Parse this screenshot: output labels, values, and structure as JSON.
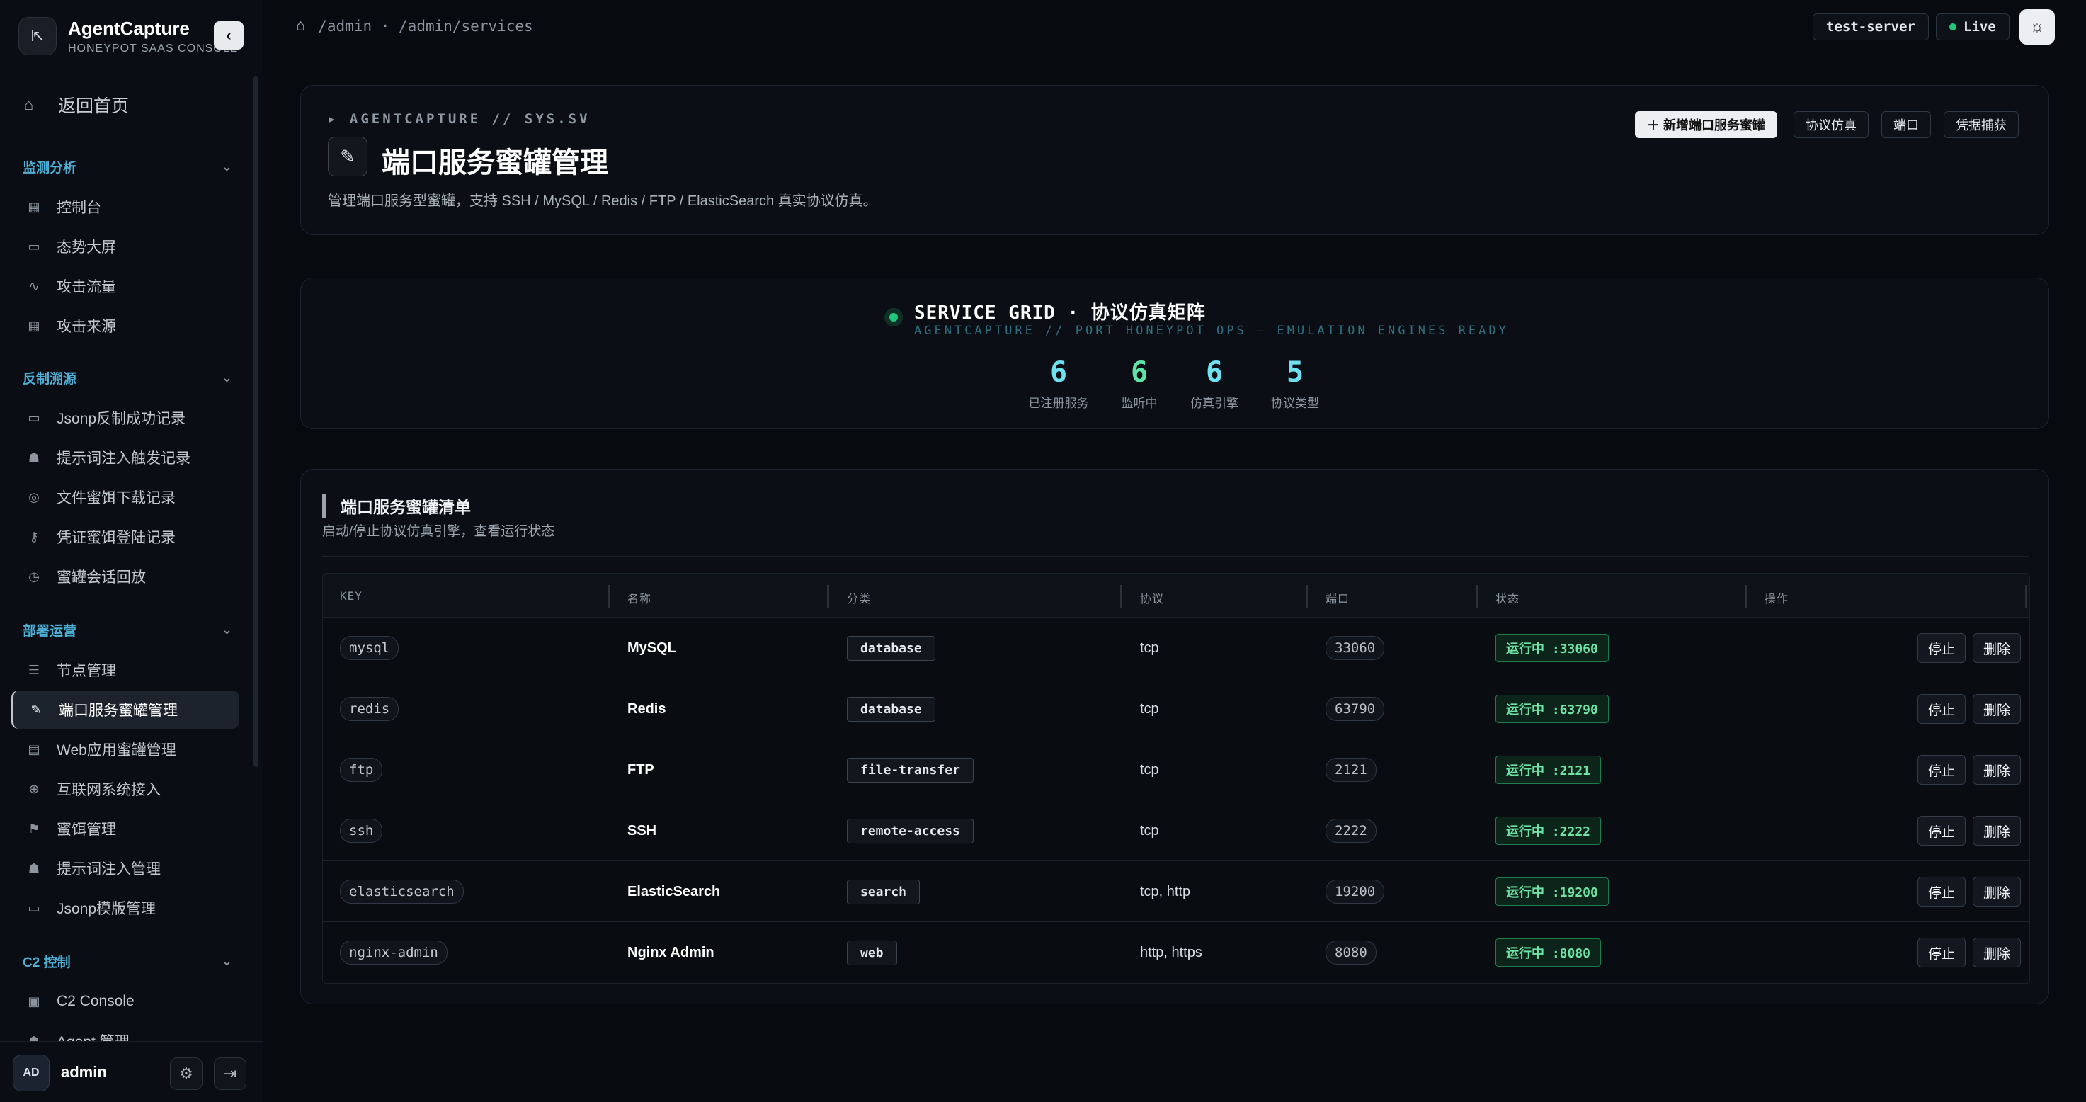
{
  "brand": {
    "name": "AgentCapture",
    "subtitle": "HONEYPOT SAAS CONSOLE"
  },
  "nav": {
    "home": "返回首页",
    "sections": [
      {
        "title": "监测分析",
        "items": [
          "控制台",
          "态势大屏",
          "攻击流量",
          "攻击来源"
        ]
      },
      {
        "title": "反制溯源",
        "items": [
          "Jsonp反制成功记录",
          "提示词注入触发记录",
          "文件蜜饵下载记录",
          "凭证蜜饵登陆记录",
          "蜜罐会话回放"
        ]
      },
      {
        "title": "部署运营",
        "items": [
          "节点管理",
          "端口服务蜜罐管理",
          "Web应用蜜罐管理",
          "互联网系统接入",
          "蜜饵管理",
          "提示词注入管理",
          "Jsonp模版管理"
        ]
      },
      {
        "title": "C2 控制",
        "items": [
          "C2 Console",
          "Agent 管理"
        ]
      }
    ],
    "active_item": "端口服务蜜罐管理"
  },
  "user": {
    "initials": "AD",
    "name": "admin"
  },
  "topbar": {
    "breadcrumb": "/admin · /admin/services",
    "server": "test-server",
    "live": "Live"
  },
  "hero": {
    "kicker": "▸ AGENTCAPTURE // SYS.SV",
    "title": "端口服务蜜罐管理",
    "desc": "管理端口服务型蜜罐，支持 SSH / MySQL / Redis / FTP / ElasticSearch 真实协议仿真。",
    "buttons": {
      "add": "＋  新增端口服务蜜罐",
      "protocol": "协议仿真",
      "port": "端口",
      "credential": "凭据捕获"
    }
  },
  "grid": {
    "title": "SERVICE GRID · 协议仿真矩阵",
    "subtitle": "AGENTCAPTURE // PORT HONEYPOT OPS — EMULATION ENGINES READY",
    "stats": [
      {
        "value": "6",
        "label": "已注册服务"
      },
      {
        "value": "6",
        "label": "监听中"
      },
      {
        "value": "6",
        "label": "仿真引擎"
      },
      {
        "value": "5",
        "label": "协议类型"
      }
    ]
  },
  "list": {
    "title": "端口服务蜜罐清单",
    "subtitle": "启动/停止协议仿真引擎，查看运行状态",
    "columns": [
      "KEY",
      "名称",
      "分类",
      "协议",
      "端口",
      "状态",
      "操作"
    ],
    "stop_label": "停止",
    "delete_label": "删除",
    "rows": [
      {
        "key": "mysql",
        "name": "MySQL",
        "category": "database",
        "protocol": "tcp",
        "port": "33060",
        "status": "运行中 :33060"
      },
      {
        "key": "redis",
        "name": "Redis",
        "category": "database",
        "protocol": "tcp",
        "port": "63790",
        "status": "运行中 :63790"
      },
      {
        "key": "ftp",
        "name": "FTP",
        "category": "file-transfer",
        "protocol": "tcp",
        "port": "2121",
        "status": "运行中 :2121"
      },
      {
        "key": "ssh",
        "name": "SSH",
        "category": "remote-access",
        "protocol": "tcp",
        "port": "2222",
        "status": "运行中 :2222"
      },
      {
        "key": "elasticsearch",
        "name": "ElasticSearch",
        "category": "search",
        "protocol": "tcp, http",
        "port": "19200",
        "status": "运行中 :19200"
      },
      {
        "key": "nginx-admin",
        "name": "Nginx Admin",
        "category": "web",
        "protocol": "http, https",
        "port": "8080",
        "status": "运行中 :8080"
      }
    ]
  },
  "colors": {
    "accent_cyan": "#6ee0f0",
    "status_green": "#22c77a",
    "section_blue": "#4fb0d6"
  }
}
